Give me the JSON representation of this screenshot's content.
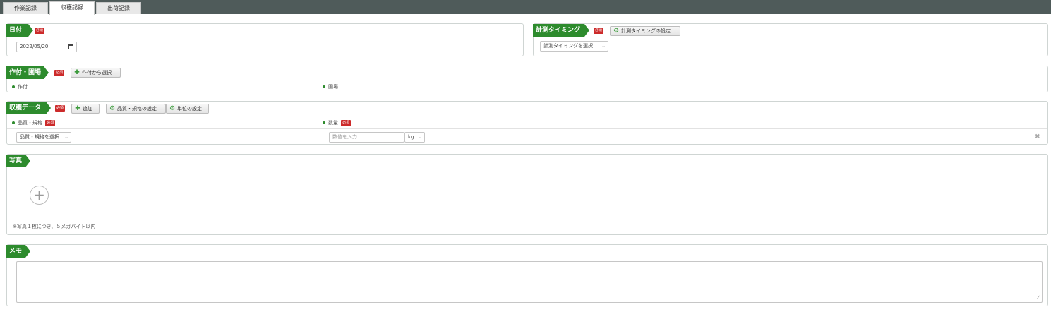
{
  "tabs": [
    {
      "label": "作業記録"
    },
    {
      "label": "収穫記録"
    },
    {
      "label": "出荷記録"
    }
  ],
  "required_badge": "必須",
  "date_panel": {
    "title": "日付",
    "value": "2022/05/20"
  },
  "timing_panel": {
    "title": "計測タイミング",
    "settings_button": "計測タイミングの設定",
    "select_value": "計測タイミングを選択"
  },
  "crop_panel": {
    "title": "作付・圃場",
    "select_button": "作付から選択",
    "crop_label": "作付",
    "field_label": "圃場"
  },
  "harvest_panel": {
    "title": "収穫データ",
    "add_button": "追加",
    "quality_settings_button": "品質・規格の設定",
    "unit_settings_button": "単位の設定",
    "quality_label": "品質・規格",
    "quantity_label": "数量",
    "quality_select": "品質・規格を選択",
    "quantity_placeholder": "数値を入力",
    "unit_select": "kg"
  },
  "photo_panel": {
    "title": "写真",
    "note": "※写真１枚につき、５メガバイト以内"
  },
  "memo_panel": {
    "title": "メモ"
  }
}
